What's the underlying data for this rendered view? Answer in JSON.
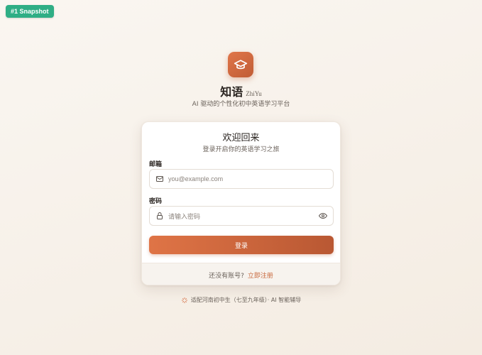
{
  "badge": "#1 Snapshot",
  "brand": {
    "name": "知语",
    "latin": "ZhiYu",
    "tagline": "AI 驱动的个性化初中英语学习平台",
    "icon": "graduation-cap-icon",
    "color": "#cf6a3f"
  },
  "card": {
    "title": "欢迎回来",
    "subtitle": "登录开启你的英语学习之旅",
    "email": {
      "label": "邮箱",
      "placeholder": "you@example.com",
      "icon": "mail-icon"
    },
    "password": {
      "label": "密码",
      "placeholder": "请输入密码",
      "icon": "lock-icon",
      "toggle_icon": "eye-icon"
    },
    "login_label": "登录",
    "footer": {
      "prompt": "还没有账号?",
      "register_link": "立即注册"
    }
  },
  "bottom_note": "适配河南初中生（七至九年级）· AI 智能辅导",
  "colors": {
    "accent": "#d46c40",
    "badge": "#2fae85"
  }
}
